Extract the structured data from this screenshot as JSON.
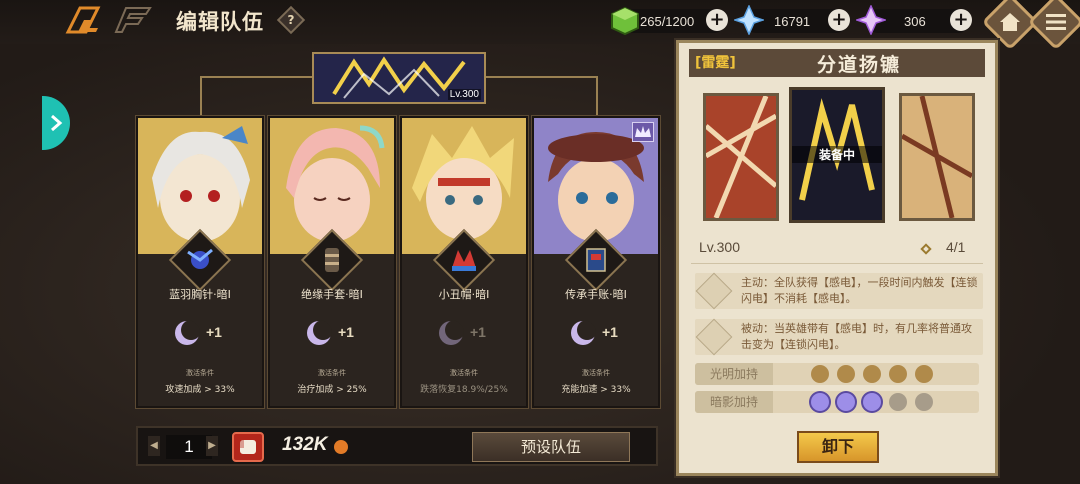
{
  "header": {
    "title": "编辑队伍",
    "help_label": "?",
    "resources": [
      {
        "icon": "stamina-cube-icon",
        "value": "265/1200"
      },
      {
        "icon": "blue-crystal-icon",
        "value": "16791"
      },
      {
        "icon": "purple-crystal-icon",
        "value": "306"
      }
    ],
    "plus_label": "+"
  },
  "team": {
    "leader_level": "Lv.300",
    "members": [
      {
        "equip_name": "蓝羽胸针·暗I",
        "bonus_plus": "+1",
        "condition_label": "激活条件",
        "bonus": "攻速加成 > 33%",
        "active": true,
        "bg": "#d8b55a"
      },
      {
        "equip_name": "绝缘手套·暗I",
        "bonus_plus": "+1",
        "condition_label": "激活条件",
        "bonus": "治疗加成 > 25%",
        "active": true,
        "bg": "#d8b55a"
      },
      {
        "equip_name": "小丑帽·暗I",
        "bonus_plus": "+1",
        "condition_label": "激活条件",
        "bonus": "跌落恢复18.9%/25%",
        "active": false,
        "bg": "#d8b55a"
      },
      {
        "equip_name": "传承手账·暗I",
        "bonus_plus": "+1",
        "condition_label": "激活条件",
        "bonus": "充能加速 > 33%",
        "active": true,
        "bg": "#8f84c8"
      }
    ]
  },
  "bottom": {
    "team_number": "1",
    "power": "132K",
    "preset_button": "预设队伍"
  },
  "panel": {
    "tag": "[雷霆]",
    "name": "分道扬镳",
    "equipped_label": "装备中",
    "level": "Lv.300",
    "stack": "4/1",
    "active_skill": "主动：全队获得【感电】，一段时间内触发【连锁闪电】不消耗【感电】。",
    "passive_skill": "被动：当英雄带有【感电】时，有几率将普通攻击变为【连锁闪电】。",
    "light_label": "光明加持",
    "light_filled": 5,
    "shadow_label": "暗影加持",
    "shadow_filled": 3,
    "unequip_button": "卸下"
  },
  "colors": {
    "accent_gold": "#f0c33b",
    "teal": "#1fc1b3",
    "shadow_purple": "#9d8ee8"
  }
}
